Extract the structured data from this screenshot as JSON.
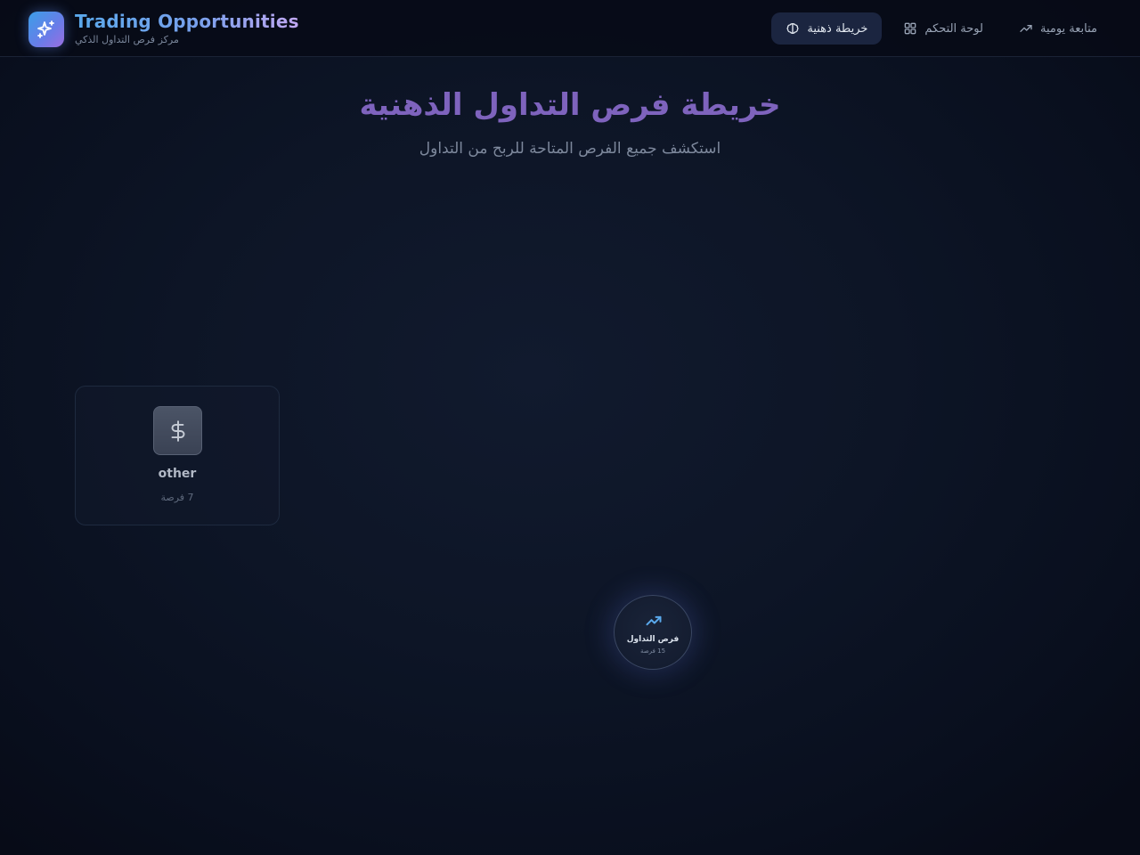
{
  "brand": {
    "title": "Trading Opportunities",
    "subtitle": "مركز فرص التداول الذكي",
    "icon": "sparkles-icon"
  },
  "nav": {
    "items": [
      {
        "label": "خريطة ذهنية",
        "icon": "brain-icon",
        "active": true
      },
      {
        "label": "لوحة التحكم",
        "icon": "grid-icon",
        "active": false
      },
      {
        "label": "متابعة يومية",
        "icon": "trending-up-icon",
        "active": false
      }
    ]
  },
  "main": {
    "title": "خريطة فرص التداول الذهنية",
    "subtitle": "استكشف جميع الفرص المتاحة للربح من التداول"
  },
  "categories": [
    {
      "name": "other",
      "count_label": "7 فرصة",
      "icon": "dollar-icon"
    }
  ],
  "center": {
    "label": "فرص التداول",
    "count_label": "15 فرصة",
    "icon": "trending-up-icon"
  },
  "colors": {
    "accent": "#5aa9ec",
    "title": "#7e63bd",
    "active_nav_bg": "#1b2540",
    "background": "#0d1526"
  }
}
